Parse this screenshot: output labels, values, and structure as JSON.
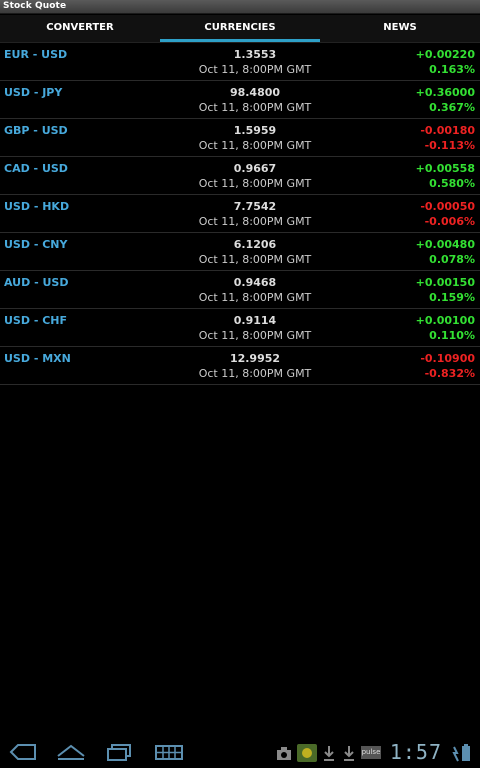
{
  "app_title": "Stock Quote",
  "tabs": [
    {
      "label": "CONVERTER"
    },
    {
      "label": "CURRENCIES"
    },
    {
      "label": "NEWS"
    }
  ],
  "active_tab": "CURRENCIES",
  "colors": {
    "accent": "#2ea0c8",
    "pair": "#47a9dc",
    "up": "#33e033",
    "down": "#ee2222"
  },
  "rows": [
    {
      "pair": "EUR - USD",
      "price": "1.3553",
      "time": "Oct 11, 8:00PM GMT",
      "change": "+0.00220",
      "percent": "0.163%",
      "direction": "up"
    },
    {
      "pair": "USD - JPY",
      "price": "98.4800",
      "time": "Oct 11, 8:00PM GMT",
      "change": "+0.36000",
      "percent": "0.367%",
      "direction": "up"
    },
    {
      "pair": "GBP - USD",
      "price": "1.5959",
      "time": "Oct 11, 8:00PM GMT",
      "change": "-0.00180",
      "percent": "-0.113%",
      "direction": "down"
    },
    {
      "pair": "CAD - USD",
      "price": "0.9667",
      "time": "Oct 11, 8:00PM GMT",
      "change": "+0.00558",
      "percent": "0.580%",
      "direction": "up"
    },
    {
      "pair": "USD - HKD",
      "price": "7.7542",
      "time": "Oct 11, 8:00PM GMT",
      "change": "-0.00050",
      "percent": "-0.006%",
      "direction": "down"
    },
    {
      "pair": "USD - CNY",
      "price": "6.1206",
      "time": "Oct 11, 8:00PM GMT",
      "change": "+0.00480",
      "percent": "0.078%",
      "direction": "up"
    },
    {
      "pair": "AUD - USD",
      "price": "0.9468",
      "time": "Oct 11, 8:00PM GMT",
      "change": "+0.00150",
      "percent": "0.159%",
      "direction": "up"
    },
    {
      "pair": "USD - CHF",
      "price": "0.9114",
      "time": "Oct 11, 8:00PM GMT",
      "change": "+0.00100",
      "percent": "0.110%",
      "direction": "up"
    },
    {
      "pair": "USD - MXN",
      "price": "12.9952",
      "time": "Oct 11, 8:00PM GMT",
      "change": "-0.10900",
      "percent": "-0.832%",
      "direction": "down"
    }
  ],
  "navbar": {
    "icons": [
      "back-icon",
      "home-icon",
      "recent-apps-icon",
      "keyboard-icon"
    ],
    "status_icons": [
      "camera-icon",
      "app-notification-icon",
      "download-icon",
      "download-icon",
      "pulse-icon",
      "battery-icon"
    ],
    "pulse_label": "pulse",
    "clock": "1:57"
  }
}
